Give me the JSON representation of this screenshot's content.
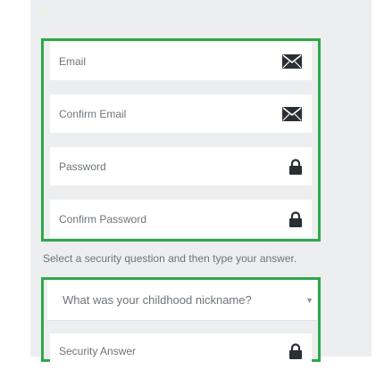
{
  "form": {
    "account_fields": [
      {
        "placeholder": "Email",
        "icon": "envelope-icon"
      },
      {
        "placeholder": "Confirm Email",
        "icon": "envelope-icon"
      },
      {
        "placeholder": "Password",
        "icon": "lock-icon"
      },
      {
        "placeholder": "Confirm Password",
        "icon": "lock-icon"
      }
    ],
    "security_hint": "Select a security question and then type your answer.",
    "security_question": {
      "selected": "What was your childhood nickname?",
      "caret": "▼"
    },
    "security_answer": {
      "placeholder": "Security Answer",
      "icon": "lock-icon"
    }
  },
  "colors": {
    "highlight_border": "#2ea84a",
    "panel_bg": "#eceeef",
    "field_bg": "#ffffff",
    "text_muted": "#6e7479",
    "icon": "#2b2f33"
  }
}
